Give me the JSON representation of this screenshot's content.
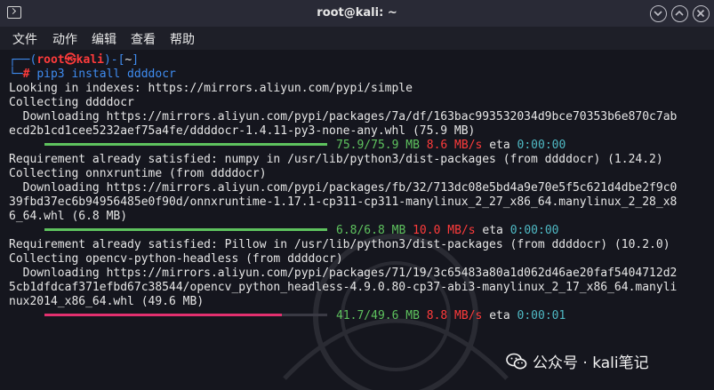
{
  "window": {
    "title": "root@kali: ~"
  },
  "menu": {
    "file": "文件",
    "action": "动作",
    "edit": "编辑",
    "view": "查看",
    "help": "帮助"
  },
  "prompt": {
    "open": "┌──(",
    "user": "root㉿kali",
    "mid": ")-[",
    "dir": "~",
    "close": "]",
    "line2": "└─",
    "hash": "# ",
    "command": "pip3 install ddddocr"
  },
  "output": {
    "l1": "Looking in indexes: https://mirrors.aliyun.com/pypi/simple",
    "l2": "Collecting ddddocr",
    "l3": "  Downloading https://mirrors.aliyun.com/pypi/packages/7a/df/163bac993532034d9bce70353b6e870c7ab",
    "l4": "ecd2b1cd1cee5232aef75a4fe/ddddocr-1.4.11-py3-none-any.whl (75.9 MB)",
    "p1": {
      "size": "75.9/75.9 MB",
      "speed": "8.6 MB/s",
      "eta_label": "eta",
      "eta": "0:00:00"
    },
    "l5": "Requirement already satisfied: numpy in /usr/lib/python3/dist-packages (from ddddocr) (1.24.2)",
    "l6": "Collecting onnxruntime (from ddddocr)",
    "l7": "  Downloading https://mirrors.aliyun.com/pypi/packages/fb/32/713dc08e5bd4a9e70e5f5c621d4dbe2f9c0",
    "l8": "39fbd37ec6b94956485e0f90d/onnxruntime-1.17.1-cp311-cp311-manylinux_2_27_x86_64.manylinux_2_28_x8",
    "l9": "6_64.whl (6.8 MB)",
    "p2": {
      "size": "6.8/6.8 MB",
      "speed": "10.0 MB/s",
      "eta_label": "eta",
      "eta": "0:00:00"
    },
    "l10": "Requirement already satisfied: Pillow in /usr/lib/python3/dist-packages (from ddddocr) (10.2.0)",
    "l11": "Collecting opencv-python-headless (from ddddocr)",
    "l12": "  Downloading https://mirrors.aliyun.com/pypi/packages/71/19/3c65483a80a1d062d46ae20faf5404712d2",
    "l13": "5cb1dfdcaf371efbd67c38544/opencv_python_headless-4.9.0.80-cp37-abi3-manylinux_2_17_x86_64.manyli",
    "l14": "nux2014_x86_64.whl (49.6 MB)",
    "p3": {
      "size": "41.7/49.6 MB",
      "speed": "8.8 MB/s",
      "eta_label": "eta",
      "eta": "0:00:01",
      "fraction": 0.84
    }
  },
  "watermark": {
    "text": "公众号 · kali笔记"
  },
  "colors": {
    "prompt_blue": "#3f8cf0",
    "prompt_red": "#ff3b3b",
    "progress_done": "#5ec25e",
    "progress_active": "#e3306f",
    "eta": "#4fb9c4"
  }
}
